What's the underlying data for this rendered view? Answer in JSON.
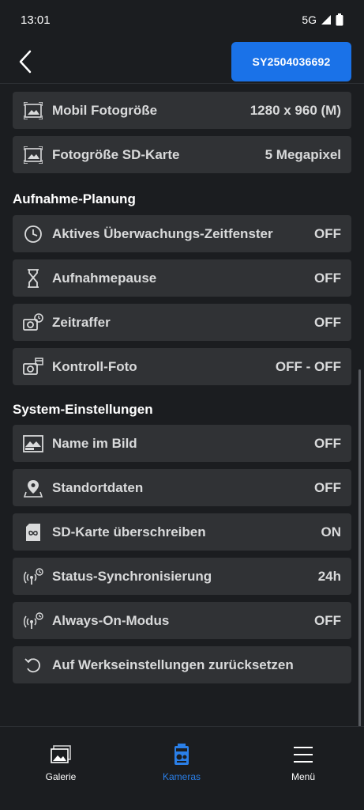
{
  "status": {
    "time": "13:01",
    "network": "5G"
  },
  "header": {
    "device_id": "SY2504036692"
  },
  "rows_top": [
    {
      "icon": "photo-size-icon",
      "label": "Mobil Fotogröße",
      "value": "1280 x 960 (M)"
    },
    {
      "icon": "photo-size-icon",
      "label": "Fotogröße SD-Karte",
      "value": "5 Megapixel"
    }
  ],
  "section_planning": {
    "title": "Aufnahme-Planung"
  },
  "rows_planning": [
    {
      "icon": "clock-icon",
      "label": "Aktives Überwachungs-Zeitfenster",
      "value": "OFF"
    },
    {
      "icon": "hourglass-icon",
      "label": "Aufnahmepause",
      "value": "OFF"
    },
    {
      "icon": "timelapse-camera-icon",
      "label": "Zeitraffer",
      "value": "OFF"
    },
    {
      "icon": "scheduled-camera-icon",
      "label": "Kontroll-Foto",
      "value": "OFF - OFF"
    }
  ],
  "section_system": {
    "title": "System-Einstellungen"
  },
  "rows_system": [
    {
      "icon": "name-in-image-icon",
      "label": "Name im Bild",
      "value": "OFF"
    },
    {
      "icon": "location-pin-icon",
      "label": "Standortdaten",
      "value": "OFF"
    },
    {
      "icon": "sd-card-loop-icon",
      "label": "SD-Karte überschreiben",
      "value": "ON"
    },
    {
      "icon": "sync-antenna-icon",
      "label": "Status-Synchronisierung",
      "value": "24h"
    },
    {
      "icon": "sync-antenna-icon",
      "label": "Always-On-Modus",
      "value": "OFF"
    },
    {
      "icon": "reset-icon",
      "label": "Auf Werkseinstellungen zurücksetzen",
      "value": ""
    }
  ],
  "bottom_nav": [
    {
      "icon": "gallery-icon",
      "label": "Galerie"
    },
    {
      "icon": "camera-trap-icon",
      "label": "Kameras"
    },
    {
      "icon": "menu-icon",
      "label": "Menü"
    }
  ],
  "colors": {
    "accent": "#1a72e8",
    "active_nav": "#2a7fe8",
    "row_bg": "#303235",
    "background": "#1b1d20"
  }
}
